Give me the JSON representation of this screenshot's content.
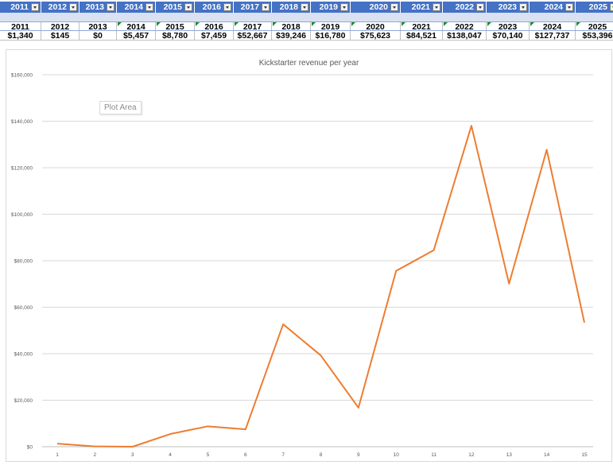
{
  "table": {
    "header_years": [
      "2011",
      "2012",
      "2013",
      "2014",
      "2015",
      "2016",
      "2017",
      "2018",
      "2019",
      "2020",
      "2021",
      "2022",
      "2023",
      "2024",
      "2025"
    ],
    "year_row": [
      "2011",
      "2012",
      "2013",
      "2014",
      "2015",
      "2016",
      "2017",
      "2018",
      "2019",
      "2020",
      "2021",
      "2022",
      "2023",
      "2024",
      "2025"
    ],
    "revenue_row": [
      "$1,340",
      "$145",
      "$0",
      "$5,457",
      "$8,780",
      "$7,459",
      "$52,667",
      "$39,246",
      "$16,780",
      "$75,623",
      "$84,521",
      "$138,047",
      "$70,140",
      "$127,737",
      "$53,396"
    ]
  },
  "chart": {
    "tooltip": "Plot Area",
    "line_color": "#ed7d31"
  },
  "chart_data": {
    "type": "line",
    "title": "Kickstarter revenue per year",
    "xlabel": "",
    "ylabel": "",
    "x": [
      1,
      2,
      3,
      4,
      5,
      6,
      7,
      8,
      9,
      10,
      11,
      12,
      13,
      14,
      15
    ],
    "series": [
      {
        "values": [
          1340,
          145,
          0,
          5457,
          8780,
          7459,
          52667,
          39246,
          16780,
          75623,
          84521,
          138047,
          70140,
          127737,
          53396
        ]
      }
    ],
    "ylim": [
      0,
      160000
    ],
    "y_ticks": [
      "$0",
      "$20,000",
      "$40,000",
      "$60,000",
      "$80,000",
      "$100,000",
      "$120,000",
      "$140,000",
      "$160,000"
    ],
    "x_ticks": [
      "1",
      "2",
      "3",
      "4",
      "5",
      "6",
      "7",
      "8",
      "9",
      "10",
      "11",
      "12",
      "13",
      "14",
      "15"
    ],
    "grid": true,
    "legend": "none"
  }
}
